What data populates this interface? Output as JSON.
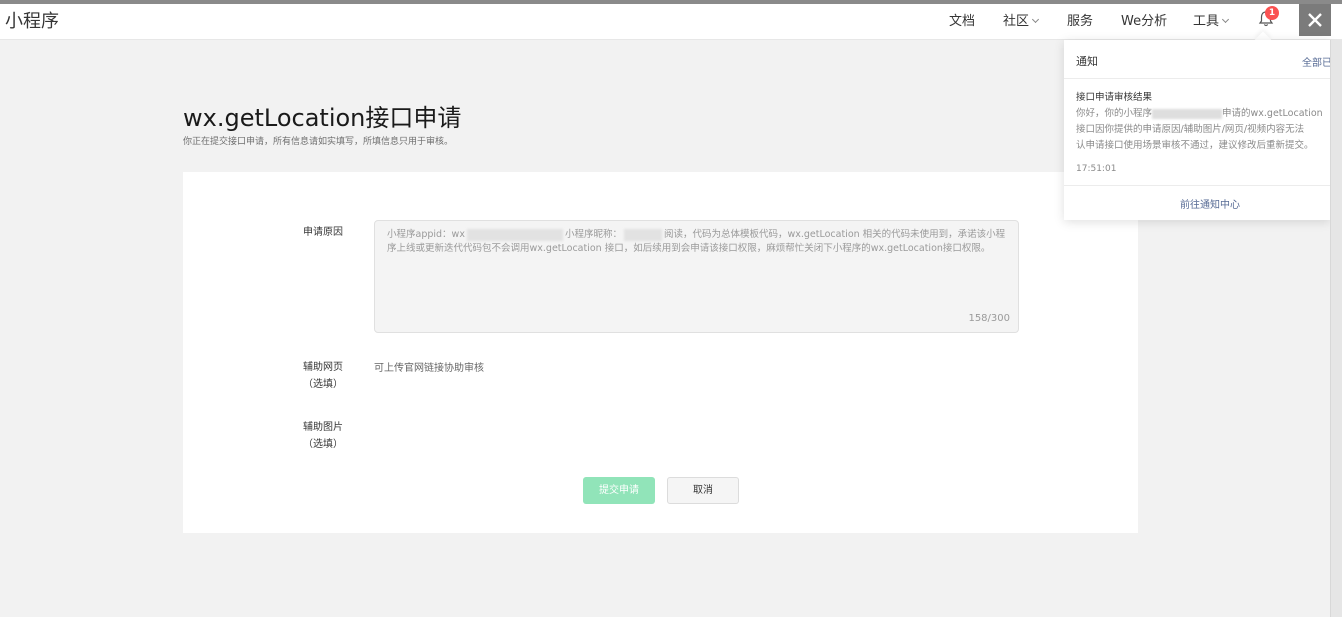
{
  "header": {
    "brand": "小程序",
    "nav": [
      "文档",
      "社区",
      "服务",
      "We分析",
      "工具"
    ],
    "notification_count": "1"
  },
  "page": {
    "title": "wx.getLocation接口申请",
    "subtitle": "你正在提交接口申请，所有信息请如实填写，所填信息只用于审核。"
  },
  "form": {
    "reason_label": "申请原因",
    "reason_part1": "小程序appid：wx",
    "reason_part2": "小程序昵称：",
    "reason_part3": "阅读，代码为总体模板代码，wx.getLocation 相关的代码未使用到，承诺该小程序上线或更新迭代代码包不会调用wx.getLocation 接口，如后续用到会申请该接口权限，麻烦帮忙关闭下小程序的wx.getLocation接口权限。",
    "reason_counter": "158/300",
    "webpage_label_line1": "辅助网页",
    "webpage_label_line2": "（选填）",
    "webpage_hint": "可上传官网链接协助审核",
    "image_label_line1": "辅助图片",
    "image_label_line2": "（选填）",
    "submit_label": "提交申请",
    "cancel_label": "取消"
  },
  "notification": {
    "title": "通知",
    "mark_all": "全部已读",
    "item_title": "接口申请审核结果",
    "item_line1_a": "你好，你的小程序",
    "item_line1_b": "申请的wx.getLocation",
    "item_line2": "接口因你提供的申请原因/辅助图片/网页/视频内容无法",
    "item_line3": "认申请接口使用场景审核不通过，建议修改后重新提交。",
    "item_time": "17:51:01",
    "center_link": "前往通知中心"
  }
}
